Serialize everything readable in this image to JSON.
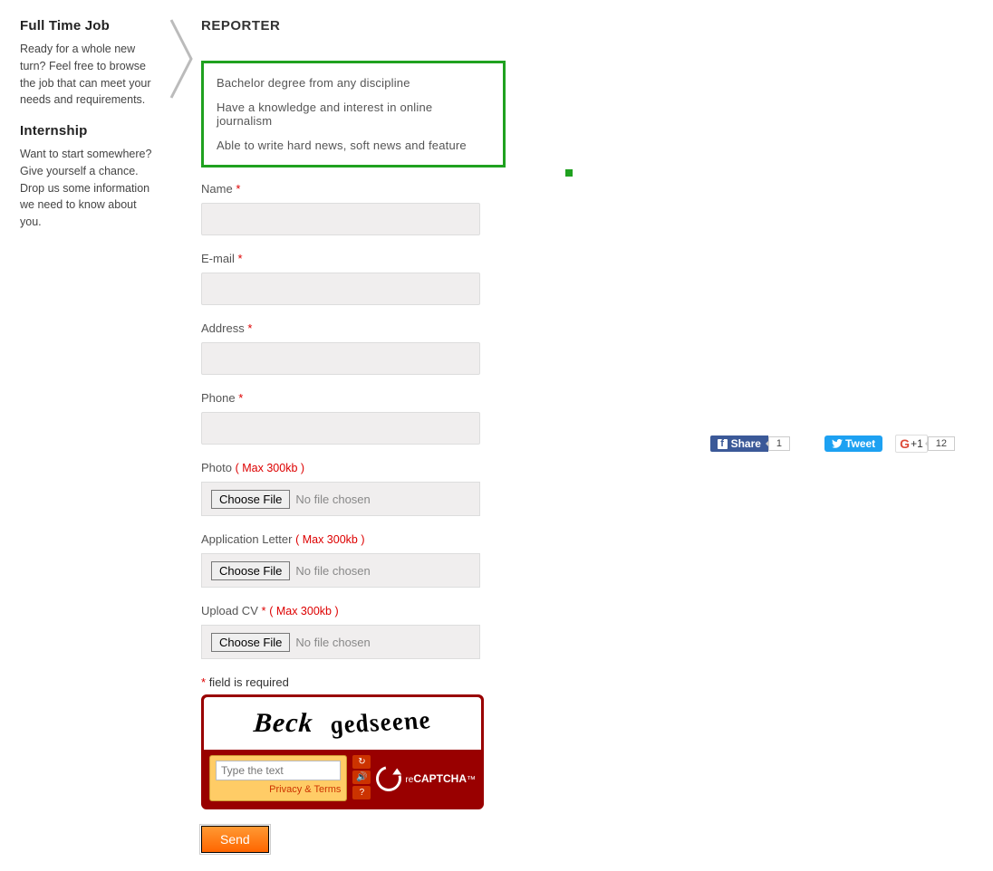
{
  "sidebar": {
    "fulltime_heading": "Full Time Job",
    "fulltime_text": "Ready for a whole new turn? Feel free to browse the job that can meet your needs and requirements.",
    "internship_heading": "Internship",
    "internship_text": "Want to start somewhere? Give yourself a chance. Drop us some information we need to know about you."
  },
  "main": {
    "title": "REPORTER",
    "requirements": [
      "Bachelor degree from any discipline",
      "Have a knowledge and interest in online journalism",
      "Able to write hard news, soft news and feature"
    ],
    "form": {
      "name_label": "Name",
      "email_label": "E-mail",
      "address_label": "Address",
      "phone_label": "Phone",
      "photo_label": "Photo",
      "app_letter_label": "Application Letter",
      "upload_cv_label": "Upload CV",
      "max_label": "( Max 300kb )",
      "choose_file": "Choose File",
      "no_file": "No file chosen",
      "required_note": "field is required",
      "star": "*",
      "send": "Send"
    },
    "captcha": {
      "word1": "Beck",
      "word2": "gedseene",
      "placeholder": "Type the text",
      "privacy": "Privacy & Terms",
      "brand_pre": "re",
      "brand": "CAPTCHA",
      "brand_tm": "™"
    }
  },
  "social": {
    "fb_label": "Share",
    "fb_count": "1",
    "tw_label": "Tweet",
    "gp_label": "+1",
    "gp_count": "12"
  }
}
